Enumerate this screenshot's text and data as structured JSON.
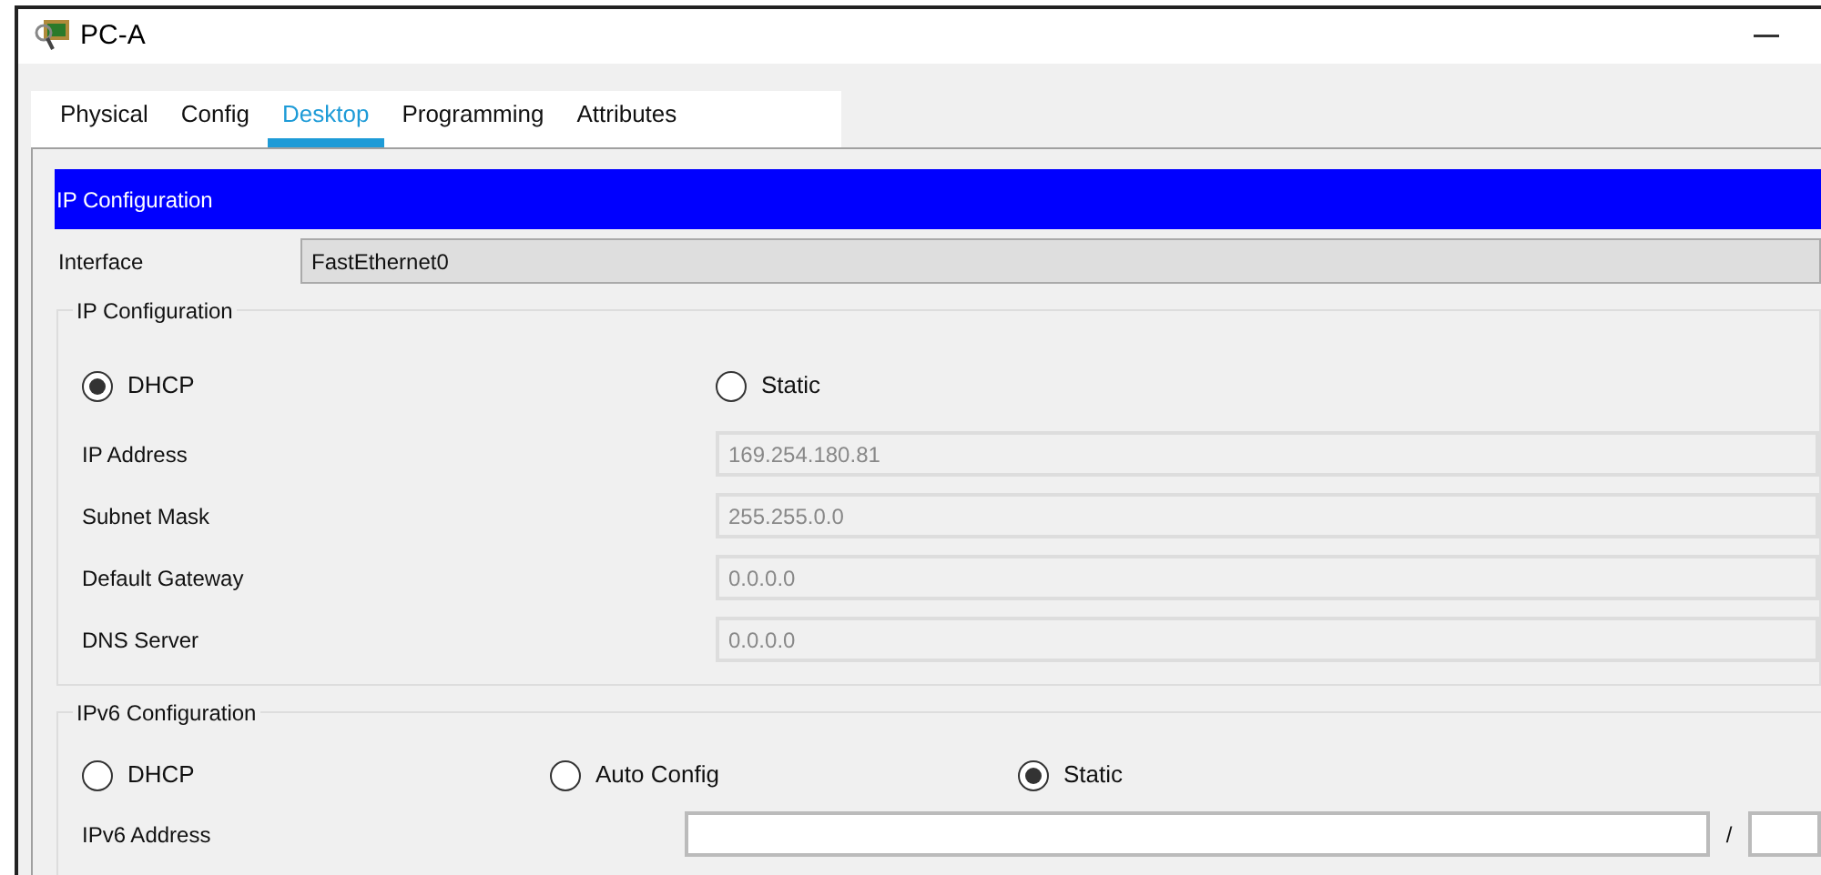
{
  "window": {
    "title": "PC-A"
  },
  "tabs": [
    {
      "label": "Physical",
      "selected": false
    },
    {
      "label": "Config",
      "selected": false
    },
    {
      "label": "Desktop",
      "selected": true
    },
    {
      "label": "Programming",
      "selected": false
    },
    {
      "label": "Attributes",
      "selected": false
    }
  ],
  "header": "IP Configuration",
  "interface": {
    "label": "Interface",
    "value": "FastEthernet0"
  },
  "ipv4": {
    "title": "IP Configuration",
    "modes": [
      {
        "label": "DHCP",
        "selected": true
      },
      {
        "label": "Static",
        "selected": false
      }
    ],
    "fields": [
      {
        "label": "IP Address",
        "value": "169.254.180.81"
      },
      {
        "label": "Subnet Mask",
        "value": "255.255.0.0"
      },
      {
        "label": "Default Gateway",
        "value": "0.0.0.0"
      },
      {
        "label": "DNS Server",
        "value": "0.0.0.0"
      }
    ]
  },
  "ipv6": {
    "title": "IPv6 Configuration",
    "modes": [
      {
        "label": "DHCP",
        "selected": false
      },
      {
        "label": "Auto Config",
        "selected": false
      },
      {
        "label": "Static",
        "selected": true
      }
    ],
    "address": {
      "label": "IPv6 Address",
      "separator": "/"
    }
  }
}
